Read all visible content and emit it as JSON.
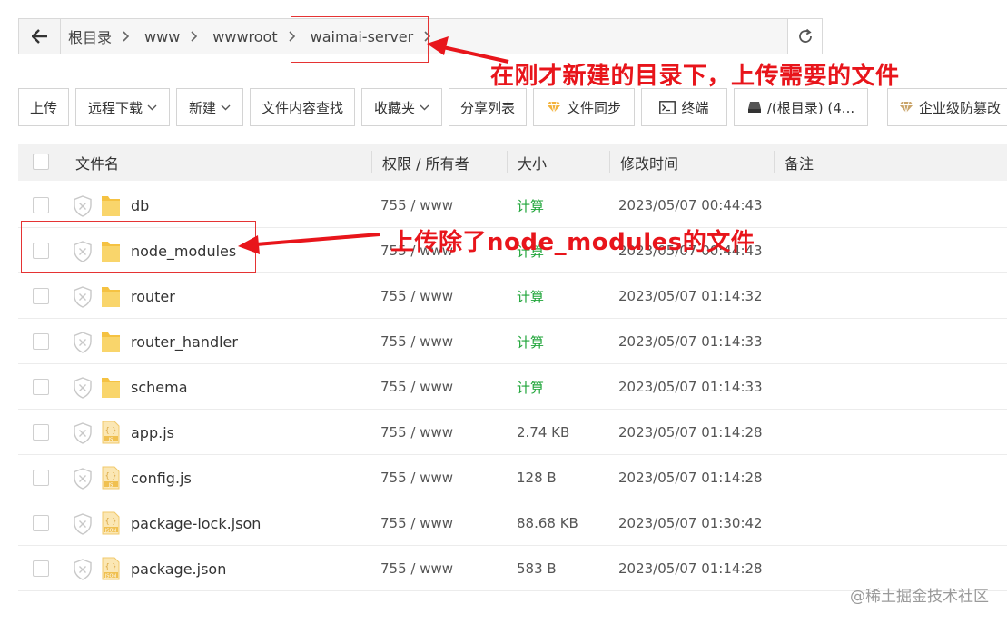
{
  "breadcrumb": {
    "items": [
      "根目录",
      "www",
      "wwwroot",
      "waimai-server"
    ]
  },
  "toolbar": {
    "upload": "上传",
    "remote_download": "远程下载",
    "new": "新建",
    "content_search": "文件内容查找",
    "favorites": "收藏夹",
    "share_list": "分享列表",
    "file_sync": "文件同步",
    "terminal": "终端",
    "disk": "/(根目录) (4...",
    "tamper_proof": "企业级防篡改"
  },
  "table": {
    "headers": {
      "name": "文件名",
      "perm_owner": "权限 / 所有者",
      "size": "大小",
      "mtime": "修改时间",
      "note": "备注"
    },
    "rows": [
      {
        "name": "db",
        "type": "folder",
        "perm": "755 / www",
        "size": "计算",
        "mtime": "2023/05/07 00:44:43"
      },
      {
        "name": "node_modules",
        "type": "folder",
        "perm": "755 / www",
        "size": "计算",
        "mtime": "2023/05/07 00:44:43"
      },
      {
        "name": "router",
        "type": "folder",
        "perm": "755 / www",
        "size": "计算",
        "mtime": "2023/05/07 01:14:32"
      },
      {
        "name": "router_handler",
        "type": "folder",
        "perm": "755 / www",
        "size": "计算",
        "mtime": "2023/05/07 01:14:33"
      },
      {
        "name": "schema",
        "type": "folder",
        "perm": "755 / www",
        "size": "计算",
        "mtime": "2023/05/07 01:14:33"
      },
      {
        "name": "app.js",
        "type": "js",
        "perm": "755 / www",
        "size": "2.74 KB",
        "mtime": "2023/05/07 01:14:28"
      },
      {
        "name": "config.js",
        "type": "js",
        "perm": "755 / www",
        "size": "128 B",
        "mtime": "2023/05/07 01:14:28"
      },
      {
        "name": "package-lock.json",
        "type": "json",
        "perm": "755 / www",
        "size": "88.68 KB",
        "mtime": "2023/05/07 01:30:42"
      },
      {
        "name": "package.json",
        "type": "json",
        "perm": "755 / www",
        "size": "583 B",
        "mtime": "2023/05/07 01:14:28"
      }
    ]
  },
  "annotations": {
    "top": "在刚才新建的目录下，上传需要的文件",
    "middle": "上传除了node_modules的文件"
  },
  "watermark": "@稀土掘金技术社区",
  "colors": {
    "accent_green": "#20a53a",
    "annotation_red": "#e8151b",
    "folder_yellow": "#f5c242",
    "header_bg": "#f2f2f2"
  }
}
